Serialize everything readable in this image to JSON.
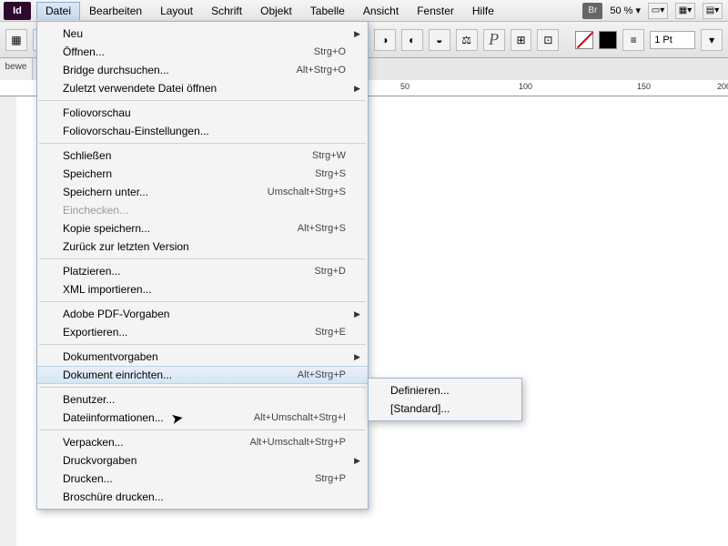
{
  "app_icon": "Id",
  "menubar": [
    "Datei",
    "Bearbeiten",
    "Layout",
    "Schrift",
    "Objekt",
    "Tabelle",
    "Ansicht",
    "Fenster",
    "Hilfe"
  ],
  "open_menu_index": 0,
  "br_label": "Br",
  "zoom": "50 %",
  "stroke_weight": "1 Pt",
  "side_label": "bewe",
  "ruler_marks": [
    {
      "pos": 440,
      "label": "50"
    },
    {
      "pos": 570,
      "label": "100"
    },
    {
      "pos": 700,
      "label": "150"
    },
    {
      "pos": 788,
      "label": "200"
    }
  ],
  "file_menu": [
    {
      "type": "item",
      "label": "Neu",
      "arrow": true
    },
    {
      "type": "item",
      "label": "Öffnen...",
      "shortcut": "Strg+O"
    },
    {
      "type": "item",
      "label": "Bridge durchsuchen...",
      "shortcut": "Alt+Strg+O"
    },
    {
      "type": "item",
      "label": "Zuletzt verwendete Datei öffnen",
      "arrow": true
    },
    {
      "type": "sep"
    },
    {
      "type": "item",
      "label": "Foliovorschau"
    },
    {
      "type": "item",
      "label": "Foliovorschau-Einstellungen..."
    },
    {
      "type": "sep"
    },
    {
      "type": "item",
      "label": "Schließen",
      "shortcut": "Strg+W"
    },
    {
      "type": "item",
      "label": "Speichern",
      "shortcut": "Strg+S"
    },
    {
      "type": "item",
      "label": "Speichern unter...",
      "shortcut": "Umschalt+Strg+S"
    },
    {
      "type": "item",
      "label": "Einchecken...",
      "disabled": true
    },
    {
      "type": "item",
      "label": "Kopie speichern...",
      "shortcut": "Alt+Strg+S"
    },
    {
      "type": "item",
      "label": "Zurück zur letzten Version"
    },
    {
      "type": "sep"
    },
    {
      "type": "item",
      "label": "Platzieren...",
      "shortcut": "Strg+D"
    },
    {
      "type": "item",
      "label": "XML importieren..."
    },
    {
      "type": "sep"
    },
    {
      "type": "item",
      "label": "Adobe PDF-Vorgaben",
      "arrow": true
    },
    {
      "type": "item",
      "label": "Exportieren...",
      "shortcut": "Strg+E"
    },
    {
      "type": "sep"
    },
    {
      "type": "item",
      "label": "Dokumentvorgaben",
      "arrow": true
    },
    {
      "type": "item",
      "label": "Dokument einrichten...",
      "shortcut": "Alt+Strg+P",
      "highlighted": true
    },
    {
      "type": "sep"
    },
    {
      "type": "item",
      "label": "Benutzer..."
    },
    {
      "type": "item",
      "label": "Dateiinformationen...",
      "shortcut": "Alt+Umschalt+Strg+I"
    },
    {
      "type": "sep"
    },
    {
      "type": "item",
      "label": "Verpacken...",
      "shortcut": "Alt+Umschalt+Strg+P"
    },
    {
      "type": "item",
      "label": "Druckvorgaben",
      "arrow": true
    },
    {
      "type": "item",
      "label": "Drucken...",
      "shortcut": "Strg+P"
    },
    {
      "type": "item",
      "label": "Broschüre drucken..."
    }
  ],
  "submenu": [
    "Definieren...",
    "[Standard]..."
  ]
}
